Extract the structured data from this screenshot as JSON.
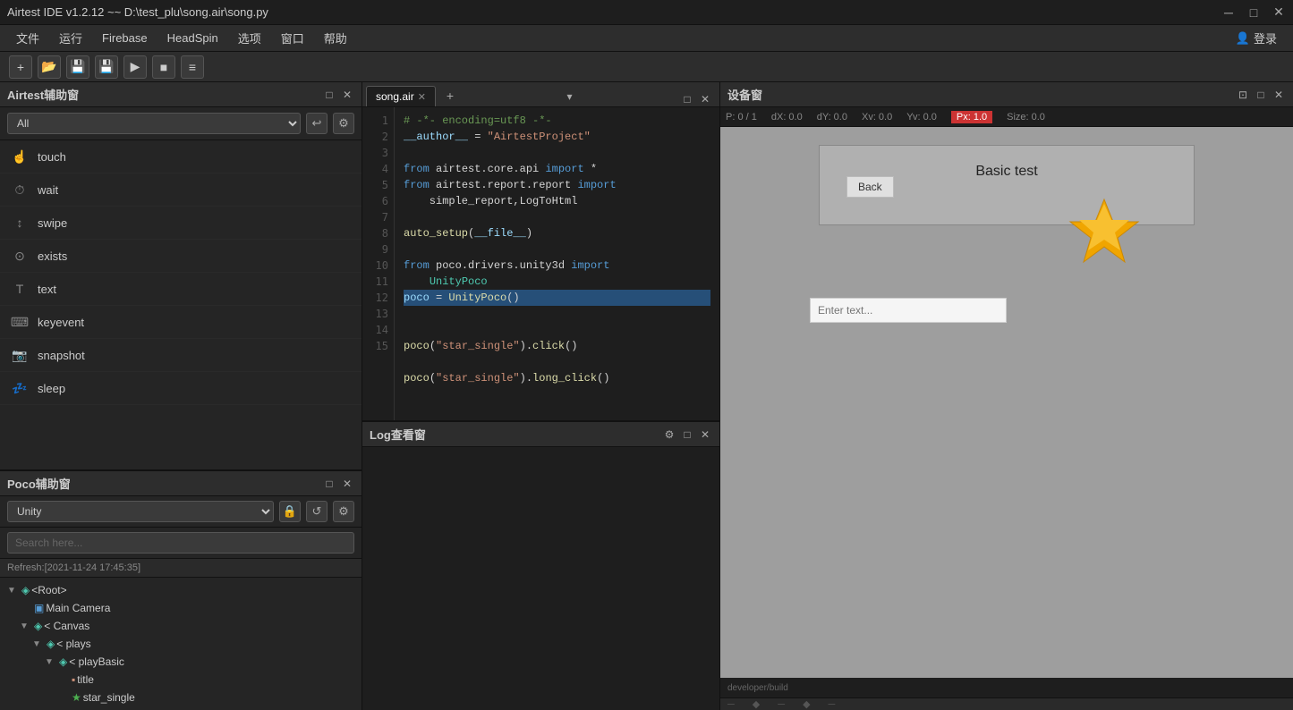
{
  "titlebar": {
    "title": "Airtest IDE v1.2.12 ~~ D:\\test_plu\\song.air\\song.py",
    "minimize": "─",
    "maximize": "□",
    "close": "✕"
  },
  "menubar": {
    "items": [
      "文件",
      "运行",
      "Firebase",
      "HeadSpin",
      "选项",
      "窗口",
      "帮助"
    ],
    "login": "登录"
  },
  "toolbar": {
    "buttons": [
      "+",
      "📁",
      "💾",
      "💾",
      "▶",
      "■",
      "≡"
    ]
  },
  "airtest_panel": {
    "title": "Airtest辅助窗",
    "filter_placeholder": "All",
    "items": [
      {
        "icon": "👆",
        "label": "touch"
      },
      {
        "icon": "⏱",
        "label": "wait"
      },
      {
        "icon": "👉",
        "label": "swipe"
      },
      {
        "icon": "🔍",
        "label": "exists"
      },
      {
        "icon": "T",
        "label": "text"
      },
      {
        "icon": "⌨",
        "label": "keyevent"
      },
      {
        "icon": "📷",
        "label": "snapshot"
      },
      {
        "icon": "💤",
        "label": "sleep"
      }
    ]
  },
  "poco_panel": {
    "title": "Poco辅助窗",
    "select_value": "Unity",
    "search_placeholder": "Search here...",
    "refresh_label": "Refresh:[2021-11-24 17:45:35]",
    "tree": [
      {
        "label": "<Root>",
        "indent": 0,
        "toggle": "▼",
        "icon": "node",
        "color": "#4ec9b0"
      },
      {
        "label": "Main Camera",
        "indent": 1,
        "toggle": "",
        "icon": "cam",
        "color": "#569cd6"
      },
      {
        "label": "< Canvas",
        "indent": 1,
        "toggle": "▼",
        "icon": "node",
        "color": "#4ec9b0"
      },
      {
        "label": "< plays",
        "indent": 2,
        "toggle": "▼",
        "icon": "node",
        "color": "#4ec9b0"
      },
      {
        "label": "< playBasic",
        "indent": 3,
        "toggle": "▼",
        "icon": "node",
        "color": "#4ec9b0"
      },
      {
        "label": "title",
        "indent": 4,
        "toggle": "",
        "icon": "file",
        "color": "#ce9178"
      },
      {
        "label": "star_single",
        "indent": 4,
        "toggle": "",
        "icon": "star",
        "color": "#4caf50"
      }
    ]
  },
  "editor": {
    "tab_label": "song.air",
    "lines": [
      {
        "num": 1,
        "code": "# -*- encoding=utf8 -*-"
      },
      {
        "num": 2,
        "code": "__author__ = \"AirtestProject\""
      },
      {
        "num": 3,
        "code": ""
      },
      {
        "num": 4,
        "code": "from airtest.core.api import *"
      },
      {
        "num": 5,
        "code": "from airtest.report.report import simple_report,LogToHtml"
      },
      {
        "num": 6,
        "code": ""
      },
      {
        "num": 7,
        "code": "auto_setup(__file__)"
      },
      {
        "num": 8,
        "code": ""
      },
      {
        "num": 9,
        "code": "from poco.drivers.unity3d import UnityPoco"
      },
      {
        "num": 10,
        "code": "poco = UnityPoco()"
      },
      {
        "num": 11,
        "code": ""
      },
      {
        "num": 12,
        "code": "poco(\"star_single\").click()"
      },
      {
        "num": 13,
        "code": ""
      },
      {
        "num": 14,
        "code": "poco(\"star_single\").long_click()"
      },
      {
        "num": 15,
        "code": ""
      }
    ]
  },
  "log_window": {
    "title": "Log查看窗"
  },
  "device_panel": {
    "title": "设备窗",
    "metrics": {
      "p": "P: 0 / 1",
      "dx": "dX: 0.0",
      "dy": "dY: 0.0",
      "xv": "Xv: 0.0",
      "yv": "Yv: 0.0",
      "px": "Px: 1.0",
      "size": "Size: 0.0"
    },
    "screen": {
      "title": "Basic test",
      "input_placeholder": "Enter text...",
      "back_btn": "Back"
    },
    "bottom_label": "developer/build",
    "scroll_markers": [
      "─",
      "◆",
      "─",
      "◆",
      "─"
    ]
  }
}
